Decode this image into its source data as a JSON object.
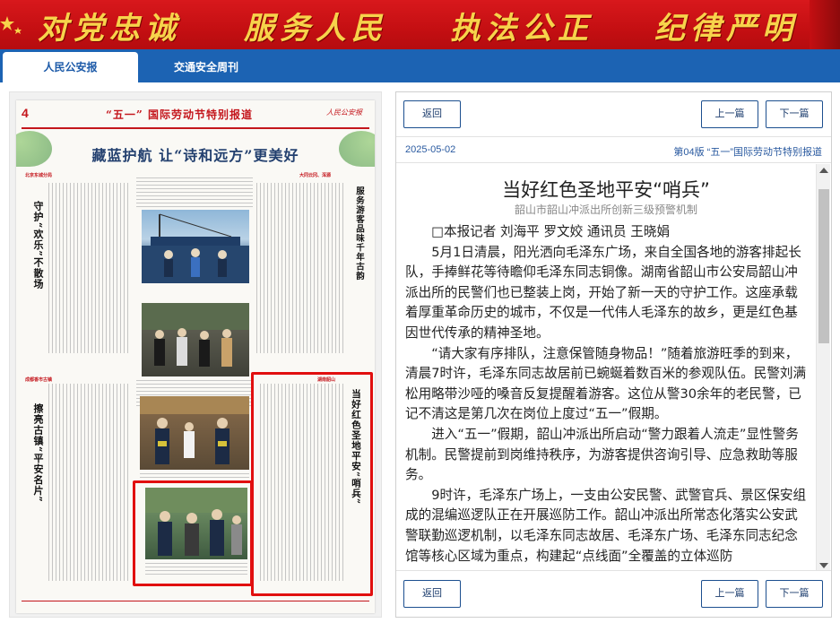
{
  "banner": {
    "slogans": [
      "对党忠诚",
      "服务人民",
      "执法公正",
      "纪律严明"
    ]
  },
  "tabs": [
    {
      "label": "人民公安报",
      "active": true
    },
    {
      "label": "交通安全周刊",
      "active": false
    }
  ],
  "newspaper": {
    "page_number": "4",
    "masthead": "“五一” 国际劳动节特别报道",
    "headline": "藏蓝护航  让“诗和远方”更美好",
    "sections": [
      {
        "place": "北京东城分局",
        "title": "守护“欢乐”不散场"
      },
      {
        "place": "大同云冈、浑源",
        "title": "服务游客品味千年古韵"
      },
      {
        "place": "成都香市古镇",
        "title": "擦亮古镇“平安名片”"
      },
      {
        "place": "湖南韶山",
        "title": "当好红色圣地平安“哨兵”"
      }
    ]
  },
  "article": {
    "back_label": "返回",
    "prev_label": "上一篇",
    "next_label": "下一篇",
    "date": "2025-05-02",
    "section": "第04版  “五一”国际劳动节特别报道",
    "title": "当好红色圣地平安“哨兵”",
    "subtitle": "韶山市韶山冲派出所创新三级预警机制",
    "paragraphs": [
      "□本报记者 刘海平 罗文姣 通讯员 王晓娟",
      "5月1日清晨，阳光洒向毛泽东广场，来自全国各地的游客排起长队，手捧鲜花等待瞻仰毛泽东同志铜像。湖南省韶山市公安局韶山冲派出所的民警们也已整装上岗，开始了新一天的守护工作。这座承载着厚重革命历史的城市，不仅是一代伟人毛泽东的故乡，更是红色基因世代传承的精神圣地。",
      "“请大家有序排队，注意保管随身物品！”随着旅游旺季的到来，清晨7时许，毛泽东同志故居前已蜿蜒着数百米的参观队伍。民警刘满松用略带沙哑的嗓音反复提醒着游客。这位从警30余年的老民警，已记不清这是第几次在岗位上度过“五一”假期。",
      "进入“五一”假期，韶山冲派出所启动“警力跟着人流走”显性警务机制。民警提前到岗维持秩序，为游客提供咨询引导、应急救助等服务。",
      "9时许，毛泽东广场上，一支由公安民警、武警官兵、景区保安组成的混编巡逻队正在开展巡防工作。韶山冲派出所常态化落实公安武警联勤巡逻机制，以毛泽东同志故居、毛泽东广场、毛泽东同志纪念馆等核心区域为重点，构建起“点线面”全覆盖的立体巡防"
    ]
  }
}
